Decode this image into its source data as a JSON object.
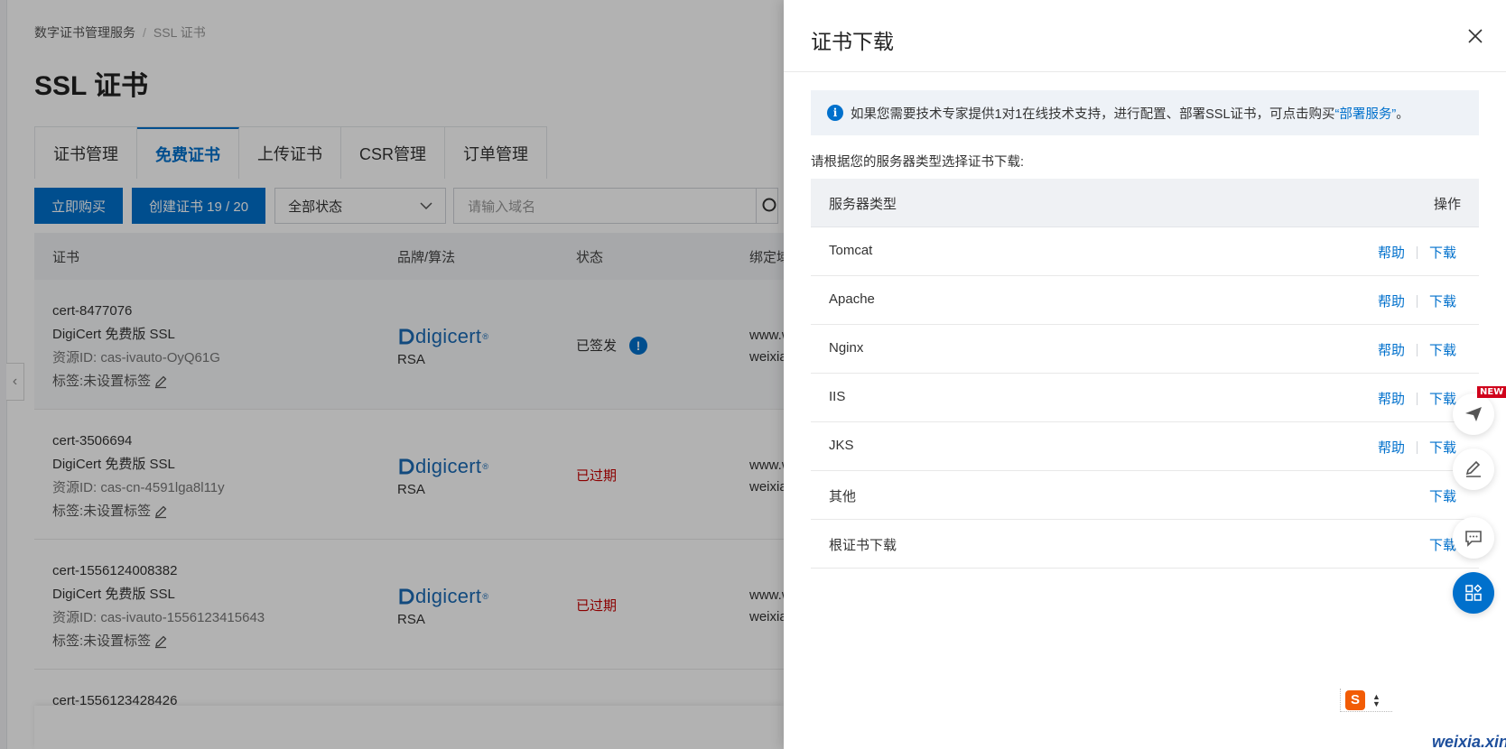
{
  "breadcrumb": {
    "root": "数字证书管理服务",
    "separator": "/",
    "current": "SSL 证书"
  },
  "page_title": "SSL 证书",
  "tabs": [
    {
      "label": "证书管理",
      "active": false
    },
    {
      "label": "免费证书",
      "active": true
    },
    {
      "label": "上传证书",
      "active": false
    },
    {
      "label": "CSR管理",
      "active": false
    },
    {
      "label": "订单管理",
      "active": false
    }
  ],
  "toolbar": {
    "buy_label": "立即购买",
    "create_label": "创建证书 19 / 20",
    "status_select_value": "全部状态",
    "search_placeholder": "请输入域名"
  },
  "table": {
    "headers": {
      "cert": "证书",
      "brand": "品牌/算法",
      "status": "状态",
      "domain": "绑定域名"
    },
    "rows": [
      {
        "name": "cert-8477076",
        "product": "DigiCert 免费版 SSL",
        "resource_id": "资源ID: cas-ivauto-OyQ61G",
        "tag": "标签:未设置标签",
        "brand": "digicert",
        "algo": "RSA",
        "status": "已签发",
        "domain1": "www.weixia.xin",
        "domain2": "weixia.xin"
      },
      {
        "name": "cert-3506694",
        "product": "DigiCert 免费版 SSL",
        "resource_id": "资源ID: cas-cn-4591lga8l11y",
        "tag": "标签:未设置标签",
        "brand": "digicert",
        "algo": "RSA",
        "status": "已过期",
        "domain1": "www.weixia.xin",
        "domain2": "weixia.xin"
      },
      {
        "name": "cert-1556124008382",
        "product": "DigiCert 免费版 SSL",
        "resource_id": "资源ID: cas-ivauto-1556123415643",
        "tag": "标签:未设置标签",
        "brand": "digicert",
        "algo": "RSA",
        "status": "已过期",
        "domain1": "www.weixia.xin",
        "domain2": "weixia.xin"
      },
      {
        "name": "cert-1556123428426"
      }
    ]
  },
  "drawer": {
    "title": "证书下载",
    "info_text": "如果您需要技术专家提供1对1在线技术支持，进行配置、部署SSL证书，可点击购买",
    "info_link": "“部署服务”",
    "info_end": "。",
    "instruction": "请根据您的服务器类型选择证书下载:",
    "table_headers": {
      "server": "服务器类型",
      "action": "操作"
    },
    "help_label": "帮助",
    "download_label": "下载",
    "servers": [
      {
        "name": "Tomcat",
        "help": true
      },
      {
        "name": "Apache",
        "help": true
      },
      {
        "name": "Nginx",
        "help": true
      },
      {
        "name": "IIS",
        "help": true
      },
      {
        "name": "JKS",
        "help": true
      },
      {
        "name": "其他",
        "help": false
      },
      {
        "name": "根证书下载",
        "help": false
      }
    ]
  },
  "floating": {
    "new_badge": "NEW"
  },
  "ime": {
    "logo": "S"
  },
  "watermark": "weixia.xin",
  "colors": {
    "primary": "#0070cc",
    "expired": "#c80000",
    "digicert": "#1a6bb5"
  }
}
